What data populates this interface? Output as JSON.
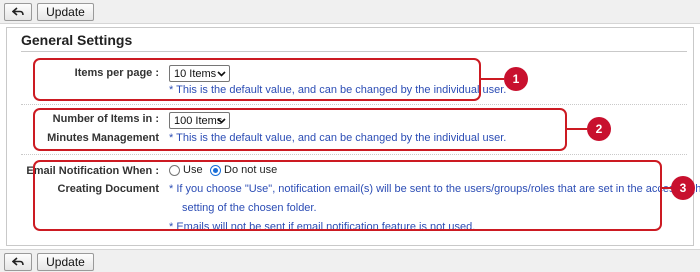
{
  "toolbar": {
    "back_icon": "back-arrow-icon",
    "update_label": "Update"
  },
  "panel": {
    "title": "General Settings",
    "items_per_page": {
      "label": "Items per page :",
      "value": "10 Items",
      "note": "* This is the default value, and can be changed by the individual user."
    },
    "minutes": {
      "label_line1": "Number of Items in :",
      "label_line2": "Minutes Management",
      "value": "100 Items",
      "note": "* This is the default value, and can be changed by the individual user."
    },
    "email": {
      "label_line1": "Email Notification When :",
      "label_line2": "Creating Document",
      "options": [
        "Use",
        "Do not use"
      ],
      "selected": "Do not use",
      "note_line1": "* If you choose \"Use\", notification email(s) will be sent to the users/groups/roles that are set in the access right",
      "note_line2": "setting of the chosen folder.",
      "note_line3": "* Emails will not be sent if email notification feature is not used."
    }
  },
  "callouts": [
    "1",
    "2",
    "3"
  ],
  "colors": {
    "highlight": "#cc1a22",
    "badge": "#c8102e",
    "note": "#2c4db5"
  }
}
